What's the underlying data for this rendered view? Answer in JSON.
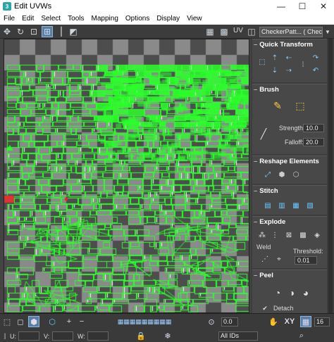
{
  "window": {
    "title": "Edit UVWs",
    "minimize": "—",
    "maximize": "☐",
    "close": "✕"
  },
  "menu": [
    "File",
    "Edit",
    "Select",
    "Tools",
    "Mapping",
    "Options",
    "Display",
    "View"
  ],
  "toolbar": {
    "uv_label": "UV",
    "texture_select": "CheckerPatt... ( Checker )"
  },
  "panel": {
    "quick_transform": "Quick Transform",
    "brush": "Brush",
    "strength_label": "Strength:",
    "strength_value": "10.0",
    "falloff_label": "Falloff:",
    "falloff_value": "20.0",
    "reshape": "Reshape Elements",
    "stitch": "Stitch",
    "explode": "Explode",
    "weld_label": "Weld",
    "threshold_label": "Threshold:",
    "threshold_value": "0.01",
    "peel": "Peel",
    "detach_label": "Detach"
  },
  "bottom": {
    "u_label": "U:",
    "v_label": "V:",
    "w_label": "W:",
    "spin_value": "0.0",
    "xy_label": "XY",
    "ids_select": "All IDs",
    "grid_value": "16"
  },
  "colors": {
    "uv_green": "#2cff2c",
    "checker_dark": "#4d4d4d",
    "checker_light": "#8a8a8a",
    "accent_blue": "#5a7ea6"
  }
}
